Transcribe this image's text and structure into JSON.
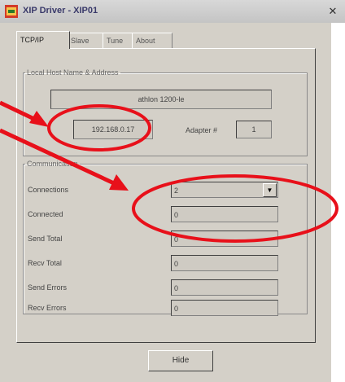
{
  "window": {
    "title": "XIP Driver - XIP01",
    "close_glyph": "✕",
    "icon": "xip-app-icon"
  },
  "tabs": [
    {
      "label": "TCP/IP",
      "active": true
    },
    {
      "label": "Slave",
      "active": false
    },
    {
      "label": "Tune",
      "active": false
    },
    {
      "label": "About",
      "active": false
    }
  ],
  "local_host": {
    "group_label": "Local Host Name & Address",
    "host_name": "athlon 1200-le",
    "ip_address": "192.168.0.17",
    "adapter_label": "Adapter #",
    "adapter_value": "1"
  },
  "communication": {
    "group_label": "Communication",
    "rows": [
      {
        "label": "Connections",
        "value": "2",
        "combo": true
      },
      {
        "label": "Connected",
        "value": "0"
      },
      {
        "label": "Send Total",
        "value": "0"
      },
      {
        "label": "Recv Total",
        "value": "0"
      },
      {
        "label": "Send Errors",
        "value": "0"
      },
      {
        "label": "Recv Errors",
        "value": "0"
      }
    ]
  },
  "hide_button": "Hide",
  "annotation_color": "#e8101a"
}
